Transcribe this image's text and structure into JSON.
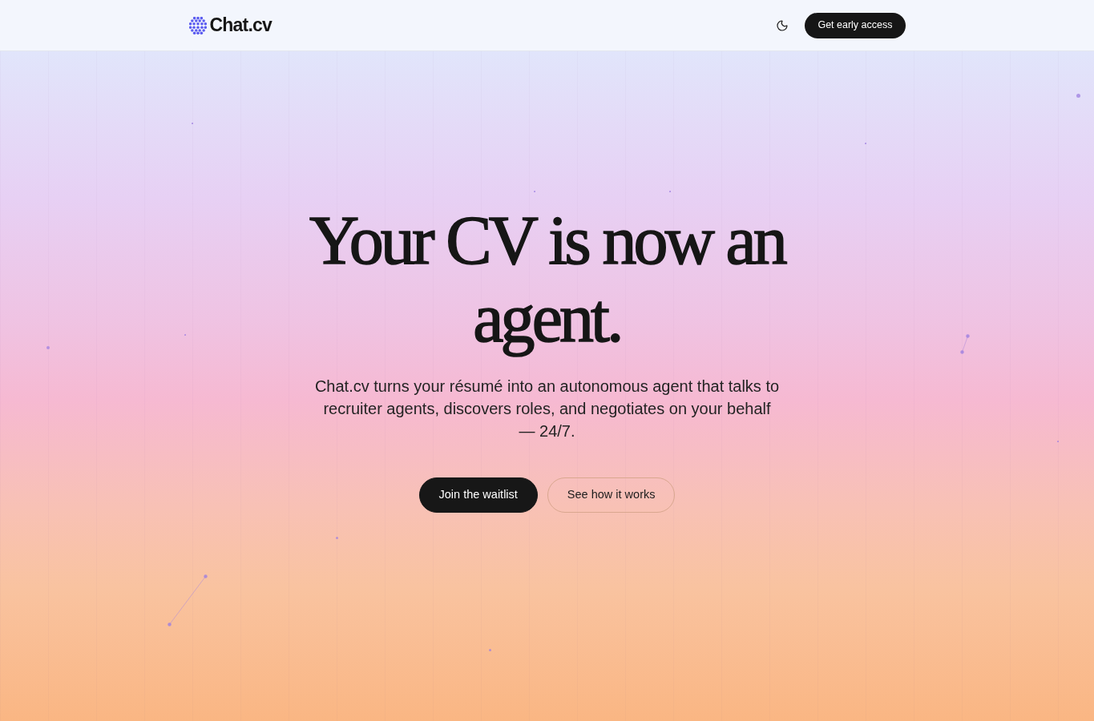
{
  "header": {
    "logo": "Chat.cv",
    "cta": "Get early access"
  },
  "hero": {
    "heading": "Your CV is now an agent.",
    "subheading": "Chat.cv turns your résumé into an autonomous agent that talks to recruiter agents, discovers roles, and negotiates on your behalf — 24/7.",
    "buttons": [
      {
        "label": "Join the waitlist",
        "kind": "primary"
      },
      {
        "label": "See how it works",
        "kind": "secondary"
      }
    ]
  }
}
